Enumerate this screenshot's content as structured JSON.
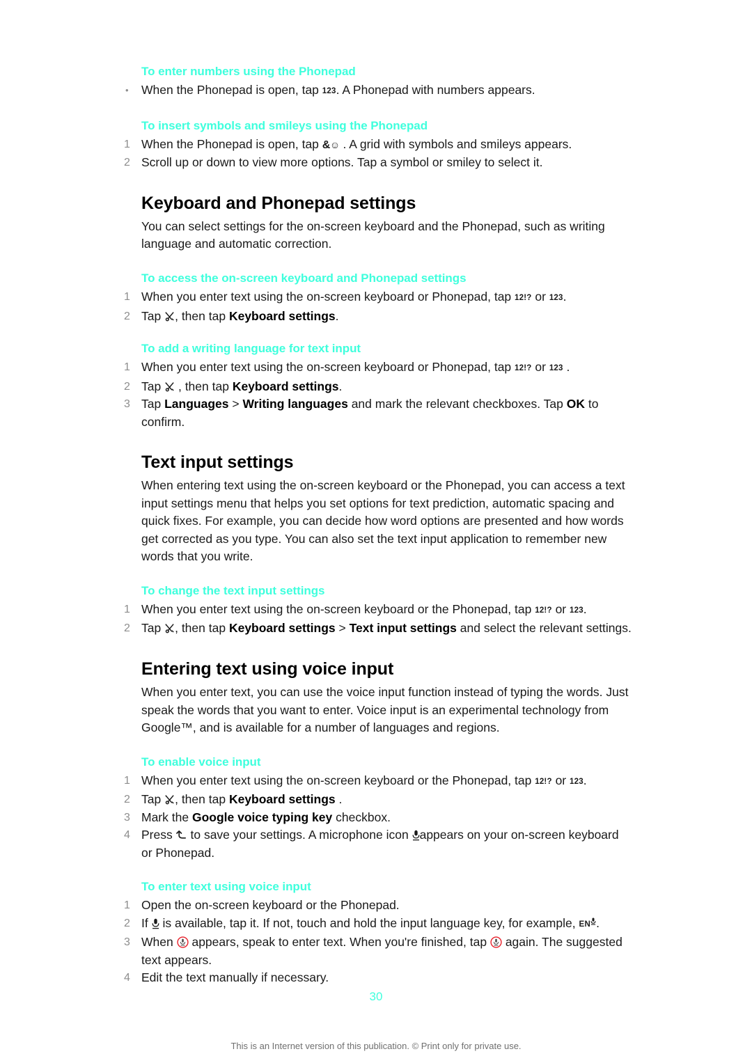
{
  "document": {
    "page_number": "30",
    "footer_note": "This is an Internet version of this publication. © Print only for private use."
  },
  "icons": {
    "numbers_key": "123",
    "symbols_key": "12!?",
    "smiley_key_amp": "&",
    "tool_icon": "tools-icon",
    "mic_icon": "microphone-icon",
    "back_icon": "back-arrow-icon",
    "mic_red_icon": "microphone-record-icon",
    "language_key": "EN"
  },
  "colors": {
    "heading_accent": "#3FFFDD",
    "body_text": "#1a1a1a",
    "marker": "#8d8d8d",
    "record_red": "#E8202A",
    "footer": "#6f6f6f"
  },
  "procedures": {
    "enter_numbers": {
      "title": "To enter numbers using the Phonepad",
      "bullet_marker": "•",
      "step1_a": "When the Phonepad is open, tap",
      "step1_b": ". A Phonepad with numbers appears."
    },
    "insert_symbols": {
      "title": "To insert symbols and smileys using the Phonepad",
      "step1_marker": "1",
      "step1_a": "When the Phonepad is open, tap",
      "step1_b": ". A grid with symbols and smileys appears.",
      "step2_marker": "2",
      "step2": "Scroll up or down to view more options. Tap a symbol or smiley to select it."
    },
    "access_settings": {
      "title": "To access the on-screen keyboard and Phonepad settings",
      "step1_marker": "1",
      "step1_a": "When you enter text using the on-screen keyboard or Phonepad, tap",
      "step1_or": "or",
      "step1_b": ".",
      "step2_marker": "2",
      "step2_a": "Tap",
      "step2_b": ", then tap",
      "step2_bold": "Keyboard settings",
      "step2_c": "."
    },
    "add_language": {
      "title": "To add a writing language for text input",
      "step1_marker": "1",
      "step1_a": "When you enter text using the on-screen keyboard or Phonepad, tap",
      "step1_or": "or",
      "step1_b": ".",
      "step2_marker": "2",
      "step2_a": "Tap",
      "step2_b": ", then tap",
      "step2_bold": "Keyboard settings",
      "step2_c": ".",
      "step3_marker": "3",
      "step3_a": "Tap",
      "step3_bold1": "Languages",
      "step3_b": ">",
      "step3_bold2": "Writing languages",
      "step3_c": "and mark the relevant checkboxes. Tap",
      "step3_bold3": "OK",
      "step3_d": "to confirm."
    },
    "change_text_input": {
      "title": "To change the text input settings",
      "step1_marker": "1",
      "step1_a": "When you enter text using the on-screen keyboard or the Phonepad, tap",
      "step1_or": "or",
      "step1_b": ".",
      "step2_marker": "2",
      "step2_a": "Tap",
      "step2_b": ", then tap",
      "step2_bold1": "Keyboard settings",
      "step2_c": ">",
      "step2_bold2": "Text input settings",
      "step2_d": "and select the relevant settings."
    },
    "enable_voice": {
      "title": "To enable voice input",
      "step1_marker": "1",
      "step1_a": "When you enter text using the on-screen keyboard or the Phonepad, tap",
      "step1_or": "or",
      "step1_b": ".",
      "step2_marker": "2",
      "step2_a": "Tap",
      "step2_b": ", then tap",
      "step2_bold": "Keyboard settings",
      "step2_c": ".",
      "step3_marker": "3",
      "step3_a": "Mark the",
      "step3_bold": "Google voice typing key",
      "step3_b": "checkbox.",
      "step4_marker": "4",
      "step4_a": "Press",
      "step4_b": "to save your settings. A microphone icon",
      "step4_c": "appears on your on-screen keyboard or Phonepad."
    },
    "enter_voice": {
      "title": "To enter text using voice input",
      "step1_marker": "1",
      "step1": "Open the on-screen keyboard or the Phonepad.",
      "step2_marker": "2",
      "step2_a": "If",
      "step2_b": "is available, tap it. If not, touch and hold the input language key, for example,",
      "step2_c": ".",
      "step3_marker": "3",
      "step3_a": "When",
      "step3_b": "appears, speak to enter text. When you're finished, tap",
      "step3_c": "again. The suggested text appears.",
      "step4_marker": "4",
      "step4": "Edit the text manually if necessary."
    }
  },
  "sections": {
    "keyboard_phonepad_settings": {
      "title": "Keyboard and Phonepad settings",
      "intro": "You can select settings for the on-screen keyboard and the Phonepad, such as writing language and automatic correction."
    },
    "text_input_settings": {
      "title": "Text input settings",
      "intro": "When entering text using the on-screen keyboard or the Phonepad, you can access a text input settings menu that helps you set options for text prediction, automatic spacing and quick fixes. For example, you can decide how word options are presented and how words get corrected as you type. You can also set the text input application to remember new words that you write."
    },
    "voice_input": {
      "title": "Entering text using voice input",
      "intro": "When you enter text, you can use the voice input function instead of typing the words. Just speak the words that you want to enter. Voice input is an experimental technology from Google™, and is available for a number of languages and regions."
    }
  }
}
